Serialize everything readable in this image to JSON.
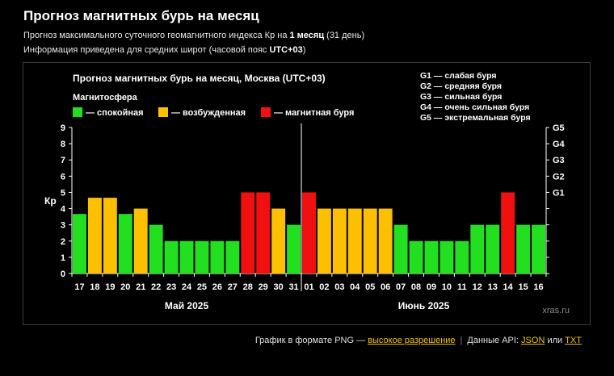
{
  "header": {
    "title": "Прогноз магнитных бурь на месяц",
    "sub1_a": "Прогноз максимального суточного геомагнитного индекса Кр на ",
    "sub1_b": "1 месяц",
    "sub1_c": " (31 день)",
    "sub2_a": "Информация приведена для средних широт (часовой пояс ",
    "sub2_b": "UTC+03",
    "sub2_c": ")"
  },
  "footer": {
    "text1": "График в формате PNG — ",
    "link_hires": "высокое разрешение",
    "sep": "|",
    "text2": "Данные API: ",
    "link_json": "JSON",
    "text3": " или ",
    "link_txt": "TXT"
  },
  "colors": {
    "quiet": "#22e01f",
    "excited": "#fcc000",
    "storm": "#f01010",
    "background": "#000000",
    "text": "#ffffff"
  },
  "chart_data": {
    "type": "bar",
    "title": "Прогноз магнитных бурь на месяц, Москва (UTC+03)",
    "legend_title": "Магнитосфера",
    "legend": [
      {
        "key": "quiet",
        "label": "— спокойная"
      },
      {
        "key": "excited",
        "label": "— возбужденная"
      },
      {
        "key": "storm",
        "label": "— магнитная буря"
      }
    ],
    "g_legend": [
      "G1 — слабая буря",
      "G2 — средняя буря",
      "G3 — сильная буря",
      "G4 — очень сильная буря",
      "G5 — экстремальная буря"
    ],
    "ylabel": "Кр",
    "ylim": [
      0,
      9
    ],
    "yticks": [
      0,
      1,
      2,
      3,
      4,
      5,
      6,
      7,
      8,
      9
    ],
    "right_ticks": [
      {
        "label": "G1",
        "value": 5
      },
      {
        "label": "G2",
        "value": 6
      },
      {
        "label": "G3",
        "value": 7
      },
      {
        "label": "G4",
        "value": 8
      },
      {
        "label": "G5",
        "value": 9
      }
    ],
    "categories": [
      "17",
      "18",
      "19",
      "20",
      "21",
      "22",
      "23",
      "24",
      "25",
      "26",
      "27",
      "28",
      "29",
      "30",
      "31",
      "01",
      "02",
      "03",
      "04",
      "05",
      "06",
      "07",
      "08",
      "09",
      "10",
      "11",
      "12",
      "13",
      "14",
      "15",
      "16"
    ],
    "values": [
      3.67,
      4.67,
      4.67,
      3.67,
      4,
      3,
      2,
      2,
      2,
      2,
      2,
      5,
      5,
      4,
      3,
      5,
      4,
      4,
      4,
      4,
      4,
      3,
      2,
      2,
      2,
      2,
      3,
      3,
      5,
      3,
      3
    ],
    "level": [
      "quiet",
      "excited",
      "excited",
      "quiet",
      "excited",
      "quiet",
      "quiet",
      "quiet",
      "quiet",
      "quiet",
      "quiet",
      "storm",
      "storm",
      "excited",
      "quiet",
      "storm",
      "excited",
      "excited",
      "excited",
      "excited",
      "excited",
      "quiet",
      "quiet",
      "quiet",
      "quiet",
      "quiet",
      "quiet",
      "quiet",
      "storm",
      "quiet",
      "quiet"
    ],
    "months": [
      {
        "label": "Май 2025",
        "start": 0,
        "end": 14
      },
      {
        "label": "Июнь 2025",
        "start": 15,
        "end": 30
      }
    ],
    "watermark": "xras.ru"
  }
}
